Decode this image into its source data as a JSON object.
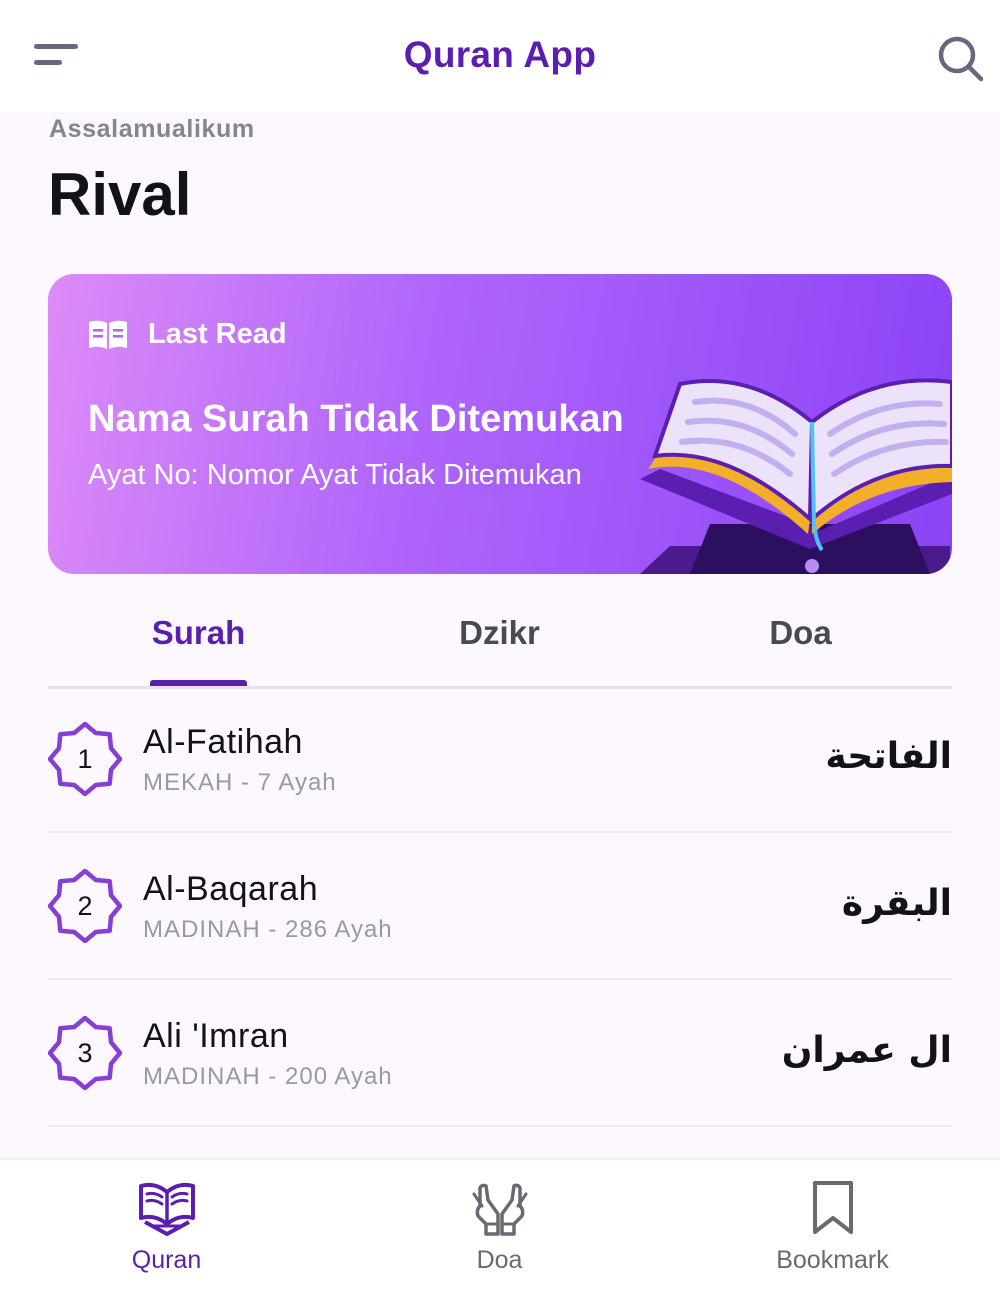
{
  "app": {
    "title": "Quran App"
  },
  "header": {
    "greeting": "Assalamualikum",
    "username": "Rival"
  },
  "last_read": {
    "label": "Last Read",
    "surah": "Nama Surah Tidak Ditemukan",
    "ayah": "Ayat No: Nomor Ayat Tidak Ditemukan"
  },
  "tabs": [
    {
      "label": "Surah",
      "active": true
    },
    {
      "label": "Dzikr",
      "active": false
    },
    {
      "label": "Doa",
      "active": false
    }
  ],
  "surahs": [
    {
      "number": "1",
      "name": "Al-Fatihah",
      "info": "MEKAH - 7 Ayah",
      "arabic": "الفاتحة"
    },
    {
      "number": "2",
      "name": "Al-Baqarah",
      "info": "MADINAH - 286 Ayah",
      "arabic": "البقرة"
    },
    {
      "number": "3",
      "name": "Ali 'Imran",
      "info": "MADINAH - 200 Ayah",
      "arabic": "ال عمران"
    }
  ],
  "bottom_nav": [
    {
      "label": "Quran",
      "icon": "quran-icon",
      "active": true
    },
    {
      "label": "Doa",
      "icon": "praying-hands-icon",
      "active": false
    },
    {
      "label": "Bookmark",
      "icon": "bookmark-icon",
      "active": false
    }
  ],
  "colors": {
    "primary": "#5b1fb0",
    "accent": "#8a43f6",
    "card_gradient_start": "#dd8bf7",
    "card_gradient_end": "#8a43f6",
    "badge_stroke": "#863ed5"
  }
}
